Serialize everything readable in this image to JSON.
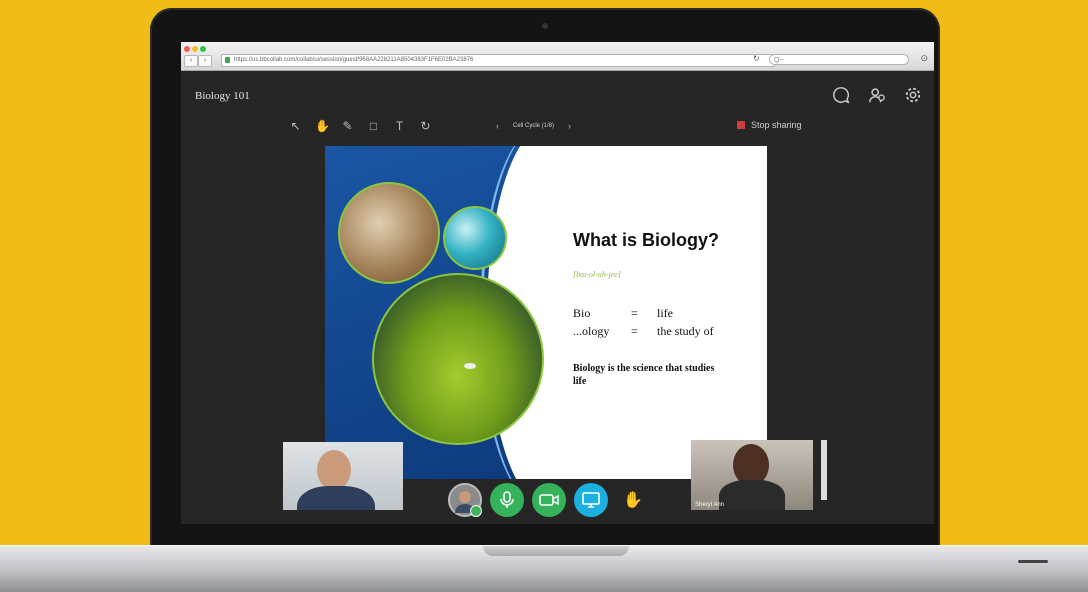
{
  "browser": {
    "url": "https://us.bbcollab.com/collab/ui/session/guest/968AA228211A8504383F1F6E02BA23876",
    "search_placeholder": "Q~"
  },
  "app": {
    "title": "Biology 101",
    "header_icons": [
      "chat-icon",
      "attendees-icon",
      "settings-icon"
    ]
  },
  "toolbar": {
    "tools": [
      "select-icon",
      "pan-icon",
      "pen-icon",
      "shape-icon",
      "text-icon",
      "clear-icon"
    ],
    "slide_title": "Cell Cycle  (1/8)",
    "stop_sharing_label": "Stop sharing"
  },
  "slide": {
    "heading": "What is Biology?",
    "phonetic": "[baɪ-ol-uh-jee]",
    "definitions": [
      {
        "term": "Bio",
        "eq": "=",
        "meaning": "life"
      },
      {
        "term": "...ology",
        "eq": "=",
        "meaning": "the study of"
      }
    ],
    "summary": "Biology is the science that studies life"
  },
  "participants": {
    "right_name": "Sheryl Ann"
  },
  "controls": [
    "avatar",
    "microphone-icon",
    "camera-icon",
    "share-icon",
    "raise-hand-icon"
  ]
}
